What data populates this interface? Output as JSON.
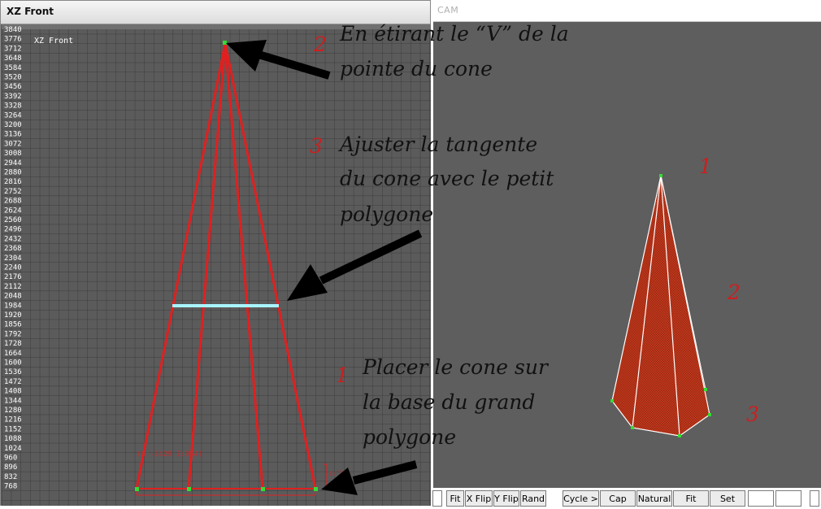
{
  "left_viewport": {
    "title": "XZ Front",
    "label": "XZ Front",
    "ruler": [
      "3840",
      "3776",
      "3712",
      "3648",
      "3584",
      "3520",
      "3456",
      "3392",
      "3328",
      "3264",
      "3200",
      "3136",
      "3072",
      "3008",
      "2944",
      "2880",
      "2816",
      "2752",
      "2688",
      "2624",
      "2560",
      "2496",
      "2432",
      "2368",
      "2304",
      "2240",
      "2176",
      "2112",
      "2048",
      "1984",
      "1920",
      "1856",
      "1792",
      "1728",
      "1664",
      "1600",
      "1536",
      "1472",
      "1408",
      "1344",
      "1280",
      "1216",
      "1152",
      "1088",
      "1024",
      "960",
      "896",
      "832",
      "768"
    ],
    "coord_readout": "(X:-3429 Z:984)",
    "z_readout": "z:16"
  },
  "right_viewport": {
    "title": "CAM",
    "labels": [
      "1",
      "2",
      "3"
    ]
  },
  "annotations": {
    "step2": {
      "number": "2",
      "lines": [
        "En étirant le “V” de la",
        "pointe du cone"
      ]
    },
    "step3": {
      "number": "3",
      "lines": [
        "Ajuster la tangente",
        "du cone avec le petit",
        "polygone"
      ]
    },
    "step1": {
      "number": "1",
      "lines": [
        "Placer le cone sur",
        "la base du grand",
        "polygone"
      ]
    }
  },
  "toolbar": {
    "buttons": [
      "Fit",
      "X Flip",
      "Y Flip",
      "Rand",
      "Cycle >",
      "Cap",
      "Natural",
      "Fit",
      "Set"
    ]
  },
  "colors": {
    "cone_edge": "#e02020",
    "tangent_line": "#a8f4ff",
    "vertex": "#33dd33",
    "step_number": "#cc1f1f"
  }
}
